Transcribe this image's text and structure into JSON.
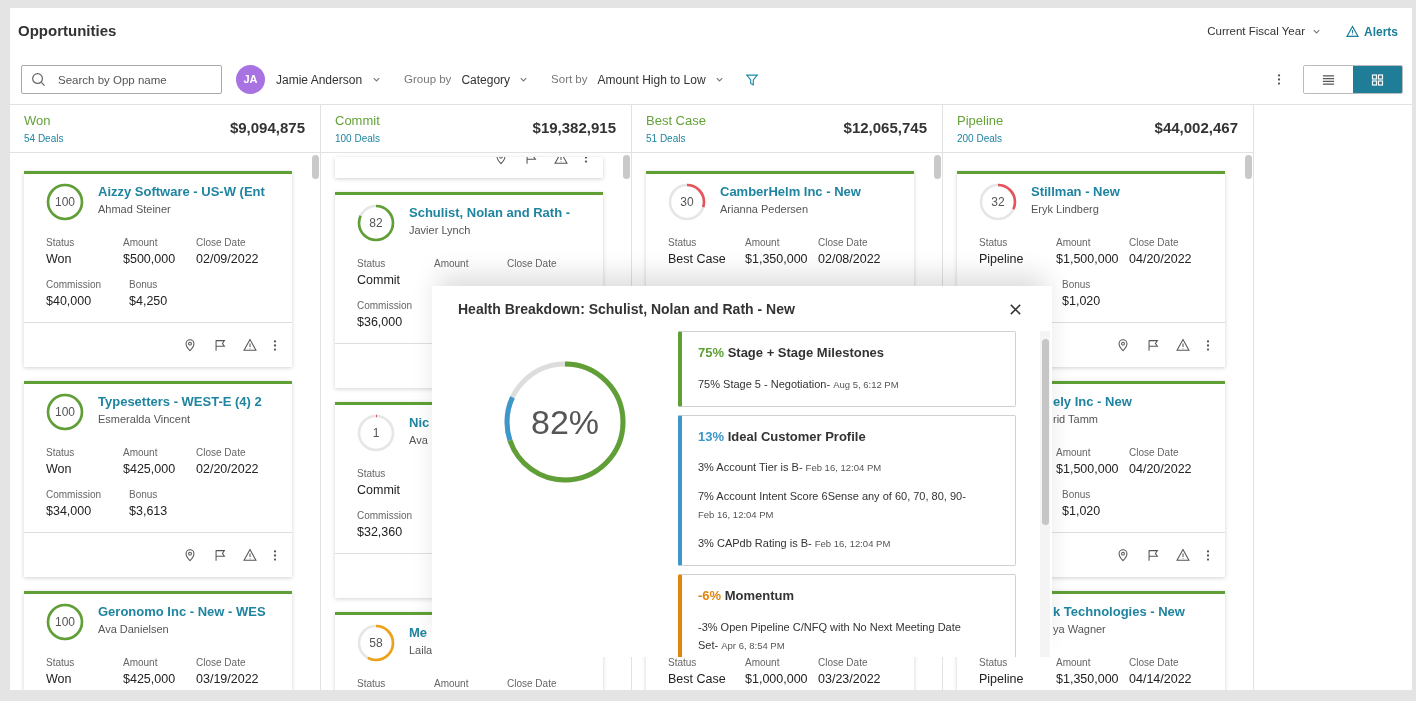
{
  "header": {
    "title": "Opportunities",
    "period": "Current Fiscal Year",
    "alerts": "Alerts"
  },
  "toolbar": {
    "search": {
      "placeholder": "Search by Opp name"
    },
    "user": {
      "initials": "JA",
      "name": "Jamie Anderson"
    },
    "group_by": {
      "label": "Group by",
      "value": "Category"
    },
    "sort_by": {
      "label": "Sort by",
      "value": "Amount High to Low"
    },
    "views": [
      {
        "kind": "list",
        "selected": false
      },
      {
        "kind": "grid",
        "selected": true
      }
    ]
  },
  "columns": [
    {
      "name": "Won",
      "count": "54 Deals",
      "total": "$9,094,875",
      "cards": [
        {
          "kind": "full",
          "score": "100",
          "title": "Aizzy Software - US-W (Ent",
          "owner": "Ahmad Steiner",
          "actions": true,
          "fields": {
            "status": {
              "label": "Status",
              "value": "Won"
            },
            "amount": {
              "label": "Amount",
              "value": "$500,000"
            },
            "close_date": {
              "label": "Close Date",
              "value": "02/09/2022"
            },
            "commission": {
              "label": "Commission",
              "value": "$40,000"
            },
            "bonus": {
              "label": "Bonus",
              "value": "$4,250"
            }
          }
        },
        {
          "kind": "full",
          "score": "100",
          "title": "Typesetters - WEST-E (4) 2",
          "owner": "Esmeralda Vincent",
          "actions": true,
          "fields": {
            "status": {
              "label": "Status",
              "value": "Won"
            },
            "amount": {
              "label": "Amount",
              "value": "$425,000"
            },
            "close_date": {
              "label": "Close Date",
              "value": "02/20/2022"
            },
            "commission": {
              "label": "Commission",
              "value": "$34,000"
            },
            "bonus": {
              "label": "Bonus",
              "value": "$3,613"
            }
          }
        },
        {
          "kind": "full",
          "score": "100",
          "title": "Geronomo Inc - New - WES",
          "owner": "Ava Danielsen",
          "fields": {
            "status": {
              "label": "Status",
              "value": "Won"
            },
            "amount": {
              "label": "Amount",
              "value": "$425,000"
            },
            "close_date": {
              "label": "Close Date",
              "value": "03/19/2022"
            }
          }
        }
      ]
    },
    {
      "name": "Commit",
      "count": "100 Deals",
      "total": "$19,382,915",
      "cards": [
        {
          "kind": "footer",
          "actions": true
        },
        {
          "kind": "full",
          "score": "82",
          "title": "Schulist, Nolan and Rath -",
          "owner": "Javier Lynch",
          "fields": {
            "status": {
              "label": "Status",
              "value": "Commit"
            },
            "amount": {
              "label": "Amount"
            },
            "close_date": {
              "label": "Close Date"
            },
            "commission": {
              "label": "Commission",
              "value": "$36,000"
            }
          }
        },
        {
          "kind": "full",
          "score": "1",
          "title": "Nic",
          "owner": "Ava",
          "fields": {
            "status": {
              "label": "Status",
              "value": "Commit"
            },
            "commission": {
              "label": "Commission",
              "value": "$32,360"
            }
          }
        },
        {
          "kind": "full",
          "score": "58",
          "title": "Me",
          "owner": "Laila",
          "fields": {
            "status": {
              "label": "Status"
            },
            "amount": {
              "label": "Amount"
            },
            "close_date": {
              "label": "Close Date"
            }
          }
        }
      ]
    },
    {
      "name": "Best Case",
      "count": "51 Deals",
      "total": "$12,065,745",
      "cards": [
        {
          "kind": "full",
          "score": "30",
          "title": "CamberHelm Inc - New",
          "owner": "Arianna Pedersen",
          "fields": {
            "status": {
              "label": "Status",
              "value": "Best Case"
            },
            "amount": {
              "label": "Amount",
              "value": "$1,350,000"
            },
            "close_date": {
              "label": "Close Date",
              "value": "02/08/2022"
            }
          }
        },
        {
          "kind": "lower",
          "fields": {
            "status": {
              "label": "Status",
              "value": "Best Case"
            },
            "amount": {
              "label": "Amount",
              "value": "$1,000,000"
            },
            "close_date": {
              "label": "Close Date",
              "value": "03/23/2022"
            }
          }
        }
      ]
    },
    {
      "name": "Pipeline",
      "count": "200 Deals",
      "total": "$44,002,467",
      "cards": [
        {
          "kind": "full",
          "score": "32",
          "title": "Stillman - New",
          "owner": "Eryk Lindberg",
          "actions": true,
          "fields": {
            "status": {
              "label": "Status",
              "value": "Pipeline"
            },
            "amount": {
              "label": "Amount",
              "value": "$1,500,000"
            },
            "close_date": {
              "label": "Close Date",
              "value": "04/20/2022"
            },
            "bonus": {
              "label": "Bonus",
              "value": "$1,020"
            }
          }
        },
        {
          "kind": "right",
          "title": "ely Inc - New",
          "owner": "rid Tamm",
          "actions": true,
          "fields": {
            "amount": {
              "label": "Amount",
              "value": "$1,500,000"
            },
            "close_date": {
              "label": "Close Date",
              "value": "04/20/2022"
            },
            "bonus": {
              "label": "Bonus",
              "value": "$1,020"
            }
          }
        },
        {
          "kind": "right",
          "title": "k Technologies - New",
          "owner": "ya Wagner",
          "fields": {
            "status": {
              "label": "Status",
              "value": "Pipeline"
            },
            "amount": {
              "label": "Amount",
              "value": "$1,350,000"
            },
            "close_date": {
              "label": "Close Date",
              "value": "04/14/2022"
            }
          }
        }
      ]
    }
  ],
  "dialog": {
    "title": "Health Breakdown: Schulist, Nolan and Rath - New",
    "score": "82%",
    "sections": [
      {
        "percent": "75%",
        "name": "Stage + Stage Milestones",
        "color": "#5f9f35",
        "items": [
          {
            "text": "75% Stage 5 - Negotiation-",
            "time": "Aug 5, 6:12 PM"
          }
        ]
      },
      {
        "percent": "13%",
        "name": "Ideal Customer Profile",
        "color": "#3d97c9",
        "items": [
          {
            "text": "3% Account Tier is B-",
            "time": "Feb 16, 12:04 PM"
          },
          {
            "text": "7% Account Intent Score 6Sense any of 60, 70, 80, 90-",
            "time": "Feb 16, 12:04 PM"
          },
          {
            "text": "3% CAPdb Rating is B-",
            "time": "Feb 16, 12:04 PM"
          }
        ]
      },
      {
        "percent": "-6%",
        "name": "Momentum",
        "color": "#e0860f",
        "items": [
          {
            "text": "-3% Open Pipeline C/NFQ with No Next Meeting Date Set-",
            "time": "Apr 6, 8:54 PM"
          }
        ]
      }
    ]
  }
}
